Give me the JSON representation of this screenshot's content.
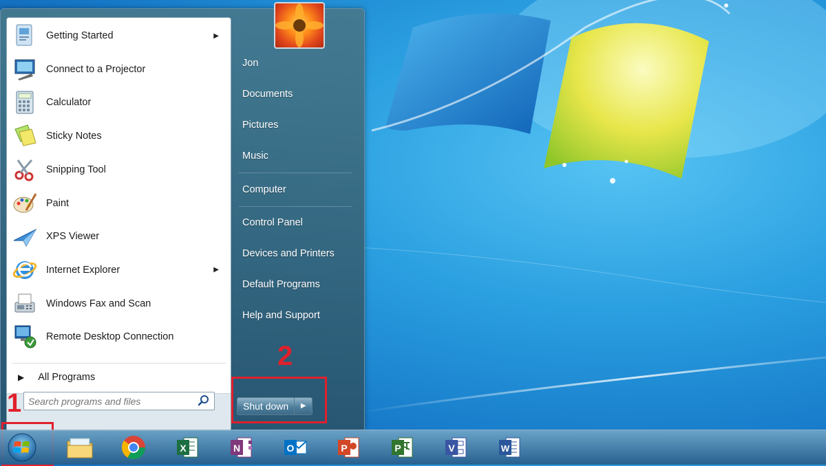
{
  "start_menu": {
    "programs": [
      {
        "label": "Getting Started",
        "icon": "getting-started-icon",
        "has_submenu": true
      },
      {
        "label": "Connect to a Projector",
        "icon": "projector-icon",
        "has_submenu": false
      },
      {
        "label": "Calculator",
        "icon": "calculator-icon",
        "has_submenu": false
      },
      {
        "label": "Sticky Notes",
        "icon": "sticky-notes-icon",
        "has_submenu": false
      },
      {
        "label": "Snipping Tool",
        "icon": "scissors-icon",
        "has_submenu": false
      },
      {
        "label": "Paint",
        "icon": "paint-palette-icon",
        "has_submenu": false
      },
      {
        "label": "XPS Viewer",
        "icon": "paper-plane-icon",
        "has_submenu": false
      },
      {
        "label": "Internet Explorer",
        "icon": "internet-explorer-icon",
        "has_submenu": true
      },
      {
        "label": "Windows Fax and Scan",
        "icon": "fax-icon",
        "has_submenu": false
      },
      {
        "label": "Remote Desktop Connection",
        "icon": "remote-desktop-icon",
        "has_submenu": false
      }
    ],
    "all_programs_label": "All Programs",
    "search_placeholder": "Search programs and files",
    "right_links": [
      "Jon",
      "Documents",
      "Pictures",
      "Music",
      "Computer",
      "Control Panel",
      "Devices and Printers",
      "Default Programs",
      "Help and Support"
    ],
    "shutdown_label": "Shut down",
    "submenu_arrow": "▶",
    "all_programs_arrow": "▶",
    "shutdown_arrow": "▶"
  },
  "annotations": {
    "step1": "1",
    "step2": "2",
    "color": "#e0202c"
  },
  "taskbar": {
    "items": [
      "file-explorer-icon",
      "chrome-icon",
      "excel-icon",
      "onenote-icon",
      "outlook-icon",
      "powerpoint-icon",
      "project-icon",
      "visio-icon",
      "word-icon"
    ],
    "letters": {
      "excel": "X",
      "onenote": "N",
      "outlook": "O",
      "powerpoint": "P",
      "project": "P",
      "visio": "V",
      "word": "W"
    }
  }
}
